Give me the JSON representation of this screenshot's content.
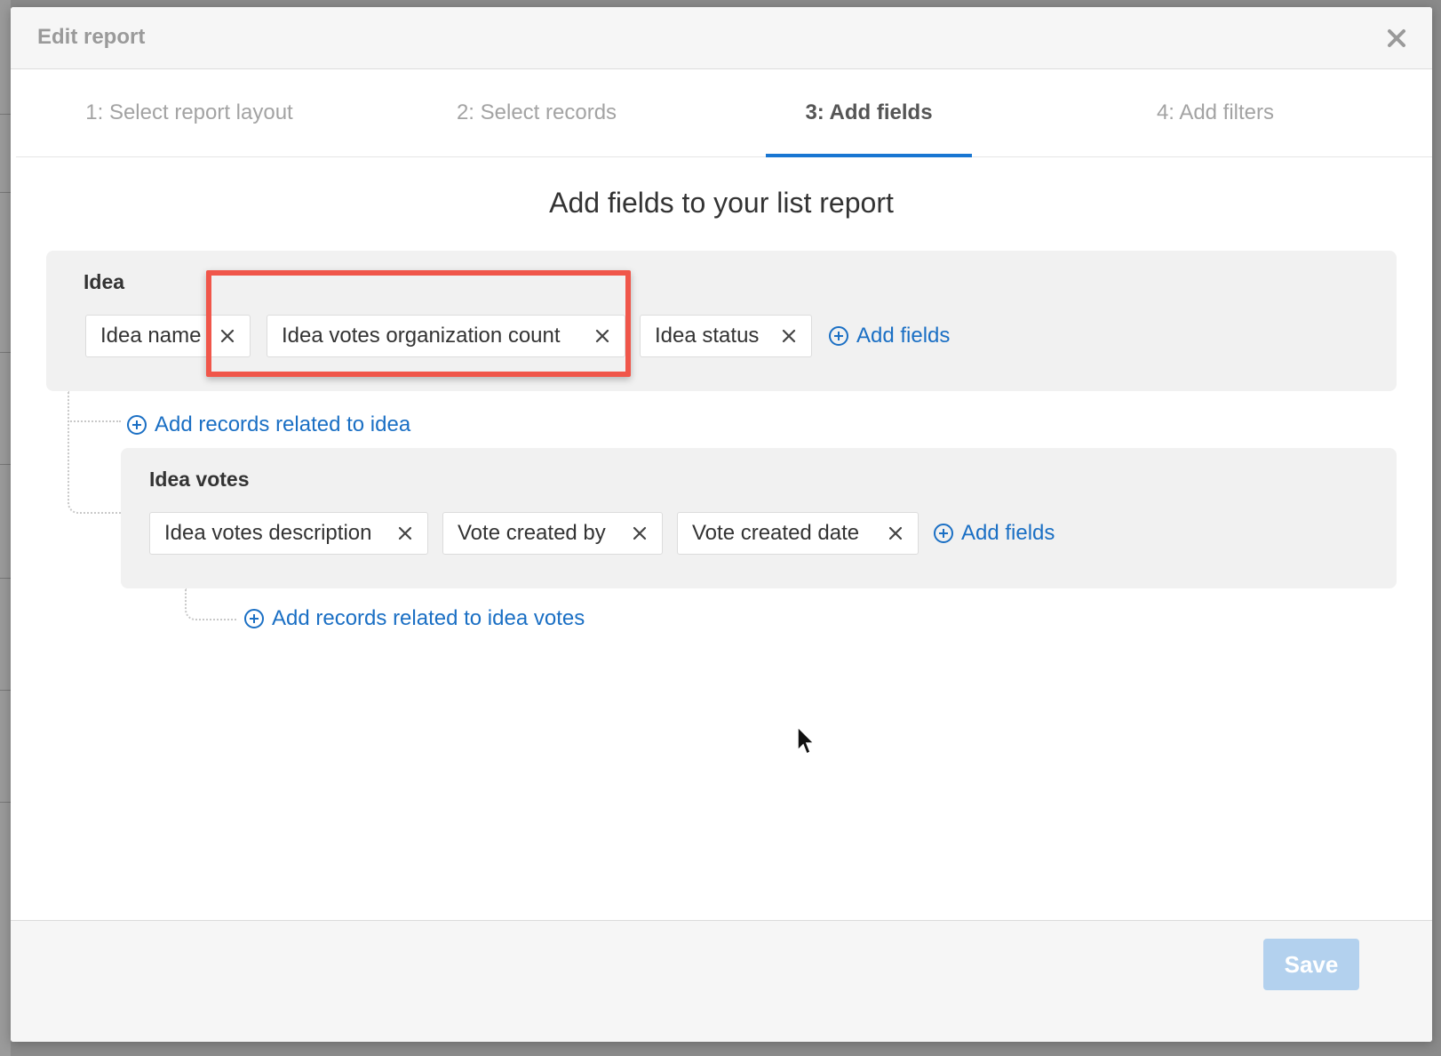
{
  "modal": {
    "title": "Edit report"
  },
  "tabs": [
    {
      "label": "1: Select report layout"
    },
    {
      "label": "2: Select records"
    },
    {
      "label": "3: Add fields",
      "active": true
    },
    {
      "label": "4: Add filters"
    }
  ],
  "heading": "Add fields to your list report",
  "idea_panel": {
    "title": "Idea",
    "chips": [
      {
        "label": "Idea name"
      },
      {
        "label": "Idea votes organization count"
      },
      {
        "label": "Idea status"
      }
    ],
    "add_fields_label": "Add fields",
    "add_related_label": "Add records related to idea"
  },
  "votes_panel": {
    "title": "Idea votes",
    "chips": [
      {
        "label": "Idea votes description"
      },
      {
        "label": "Vote created by"
      },
      {
        "label": "Vote created date"
      }
    ],
    "add_fields_label": "Add fields",
    "add_related_label": "Add records related to idea votes"
  },
  "footer": {
    "save_label": "Save"
  },
  "colors": {
    "accent": "#1976d2",
    "link": "#1a6fc4",
    "highlight": "#f0564a",
    "save_disabled": "#b3d1ee"
  }
}
